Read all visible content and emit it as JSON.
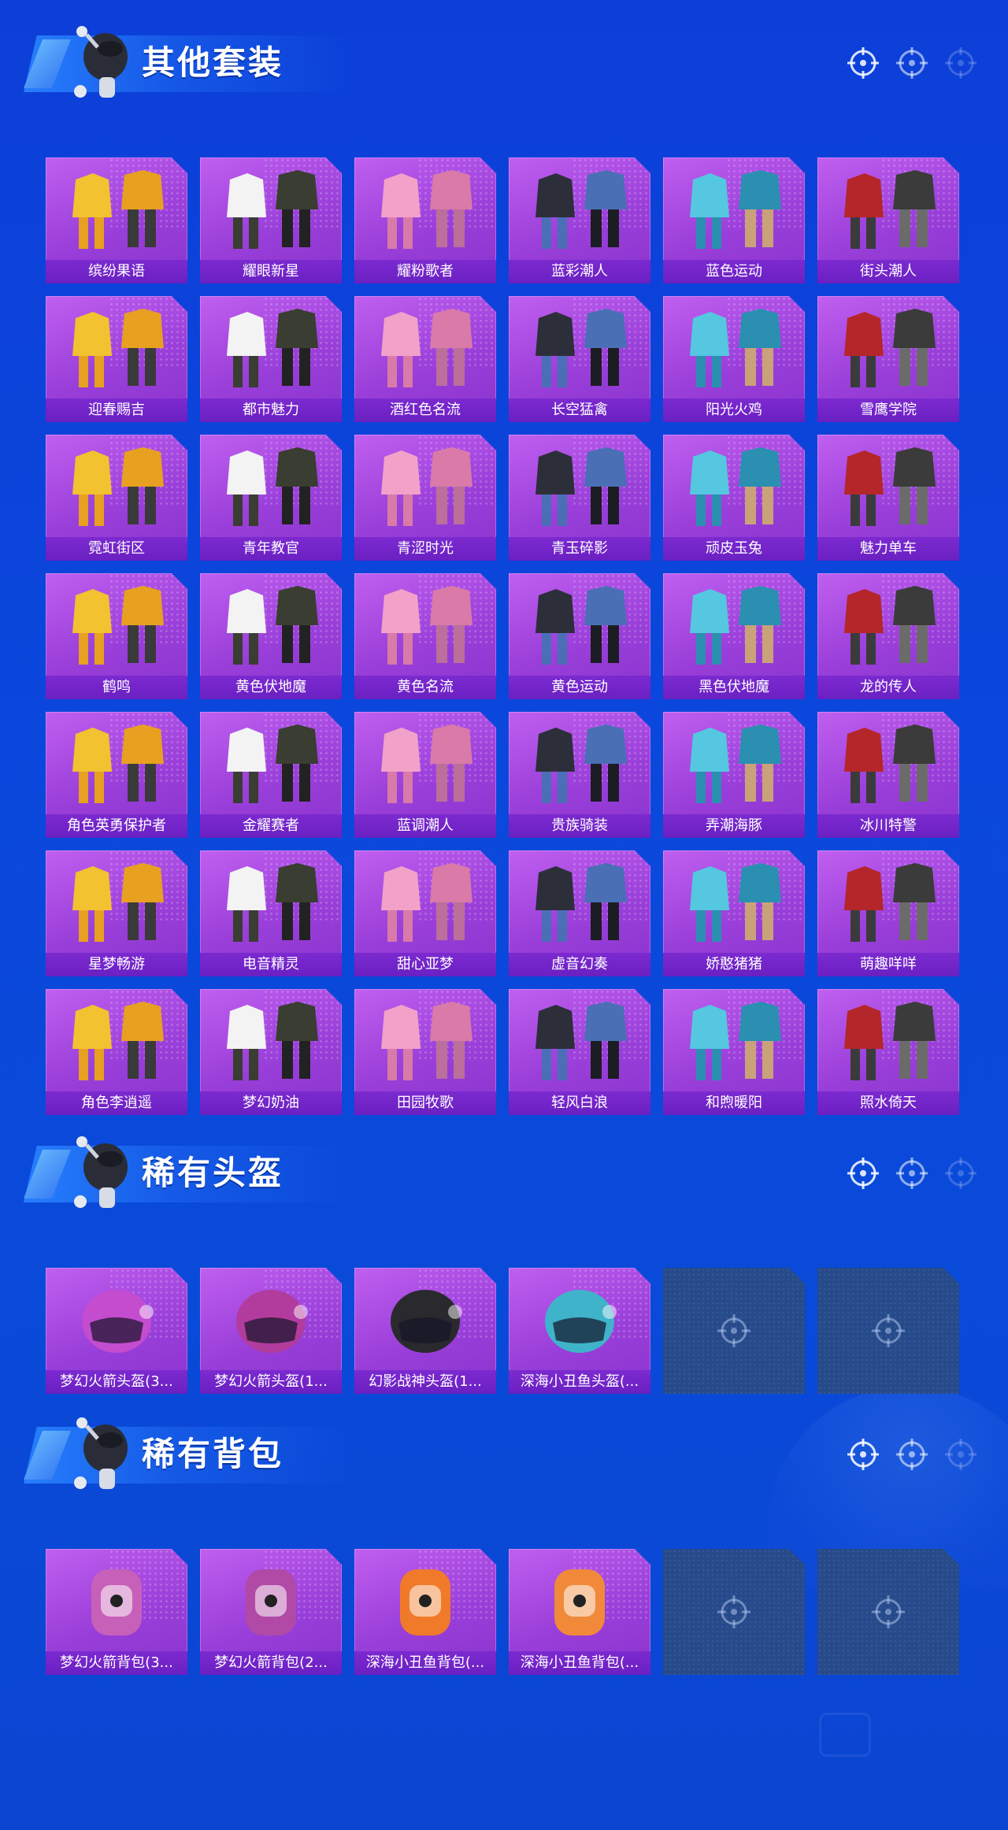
{
  "colors": {
    "background": "#0b45d8",
    "card": "#a84ae2",
    "label_bar": "#7426c9",
    "empty_slot": "#264a8a"
  },
  "sections": {
    "outfits": {
      "title": "其他套装",
      "items": [
        {
          "label": "缤纷果语",
          "art": "yellow-outfit"
        },
        {
          "label": "耀眼新星",
          "art": "white-shirt-outfit"
        },
        {
          "label": "耀粉歌者",
          "art": "pink-outfit"
        },
        {
          "label": "蓝彩潮人",
          "art": "black-outfit"
        },
        {
          "label": "蓝色运动",
          "art": "blue-outfit"
        },
        {
          "label": "街头潮人",
          "art": "red-jacket-outfit"
        },
        {
          "label": "迎春赐吉",
          "art": "red-outfit"
        },
        {
          "label": "都市魅力",
          "art": "black-red-outfit"
        },
        {
          "label": "酒红色名流",
          "art": "dark-suit-outfit"
        },
        {
          "label": "长空猛禽",
          "art": "camo-outfit"
        },
        {
          "label": "阳光火鸡",
          "art": "blue-yellow-outfit"
        },
        {
          "label": "雪鹰学院",
          "art": "white-uniform-outfit"
        },
        {
          "label": "霓虹街区",
          "art": "pink-yellow-outfit"
        },
        {
          "label": "青年教官",
          "art": "white-jacket-outfit"
        },
        {
          "label": "青涩时光",
          "art": "black-tie-outfit"
        },
        {
          "label": "青玉碎影",
          "art": "green-outfit"
        },
        {
          "label": "顽皮玉兔",
          "art": "bunny-outfit"
        },
        {
          "label": "魅力单车",
          "art": "yellow-shirt-outfit"
        },
        {
          "label": "鹤鸣",
          "art": "navy-jacket-outfit"
        },
        {
          "label": "黄色伏地魔",
          "art": "yellow-hood-outfit"
        },
        {
          "label": "黄色名流",
          "art": "tan-suit-outfit"
        },
        {
          "label": "黄色运动",
          "art": "lime-outfit"
        },
        {
          "label": "黑色伏地魔",
          "art": "black-hood-outfit"
        },
        {
          "label": "龙的传人",
          "art": "red-dress-outfit"
        },
        {
          "label": "角色英勇保护者",
          "art": "armor-character"
        },
        {
          "label": "金耀赛者",
          "art": "gold-racer-outfit"
        },
        {
          "label": "蓝调潮人",
          "art": "grey-outfit"
        },
        {
          "label": "贵族骑装",
          "art": "brown-outfit"
        },
        {
          "label": "弄潮海豚",
          "art": "dolphin-outfit"
        },
        {
          "label": "冰川特警",
          "art": "white-tactical-outfit"
        },
        {
          "label": "星梦畅游",
          "art": "astronaut-outfit"
        },
        {
          "label": "电音精灵",
          "art": "black-zip-outfit"
        },
        {
          "label": "甜心亚梦",
          "art": "pink-black-outfit"
        },
        {
          "label": "虚音幻奏",
          "art": "lavender-outfit"
        },
        {
          "label": "娇憨猪猪",
          "art": "piggy-outfit"
        },
        {
          "label": "萌趣咩咩",
          "art": "sheep-outfit"
        },
        {
          "label": "角色李逍遥",
          "art": "hero-character"
        },
        {
          "label": "梦幻奶油",
          "art": "cream-dress-outfit"
        },
        {
          "label": "田园牧歌",
          "art": "floral-dress-outfit"
        },
        {
          "label": "轻风白浪",
          "art": "white-dress-outfit"
        },
        {
          "label": "和煦暖阳",
          "art": "pastel-outfit"
        },
        {
          "label": "照水倚天",
          "art": "dark-armor-outfit"
        }
      ]
    },
    "helmets": {
      "title": "稀有头盔",
      "items": [
        {
          "label": "梦幻火箭头盔(3...",
          "art": "pink-helmet-3"
        },
        {
          "label": "梦幻火箭头盔(1...",
          "art": "pink-helmet-1"
        },
        {
          "label": "幻影战神头盔(1...",
          "art": "black-helmet"
        },
        {
          "label": "深海小丑鱼头盔(...",
          "art": "teal-helmet"
        }
      ],
      "empty_slots": 2
    },
    "backpacks": {
      "title": "稀有背包",
      "items": [
        {
          "label": "梦幻火箭背包(3...",
          "art": "pink-backpack-3"
        },
        {
          "label": "梦幻火箭背包(2...",
          "art": "pink-backpack-2"
        },
        {
          "label": "深海小丑鱼背包(...",
          "art": "clownfish-backpack-a"
        },
        {
          "label": "深海小丑鱼背包(...",
          "art": "clownfish-backpack-b"
        }
      ],
      "empty_slots": 2
    }
  }
}
